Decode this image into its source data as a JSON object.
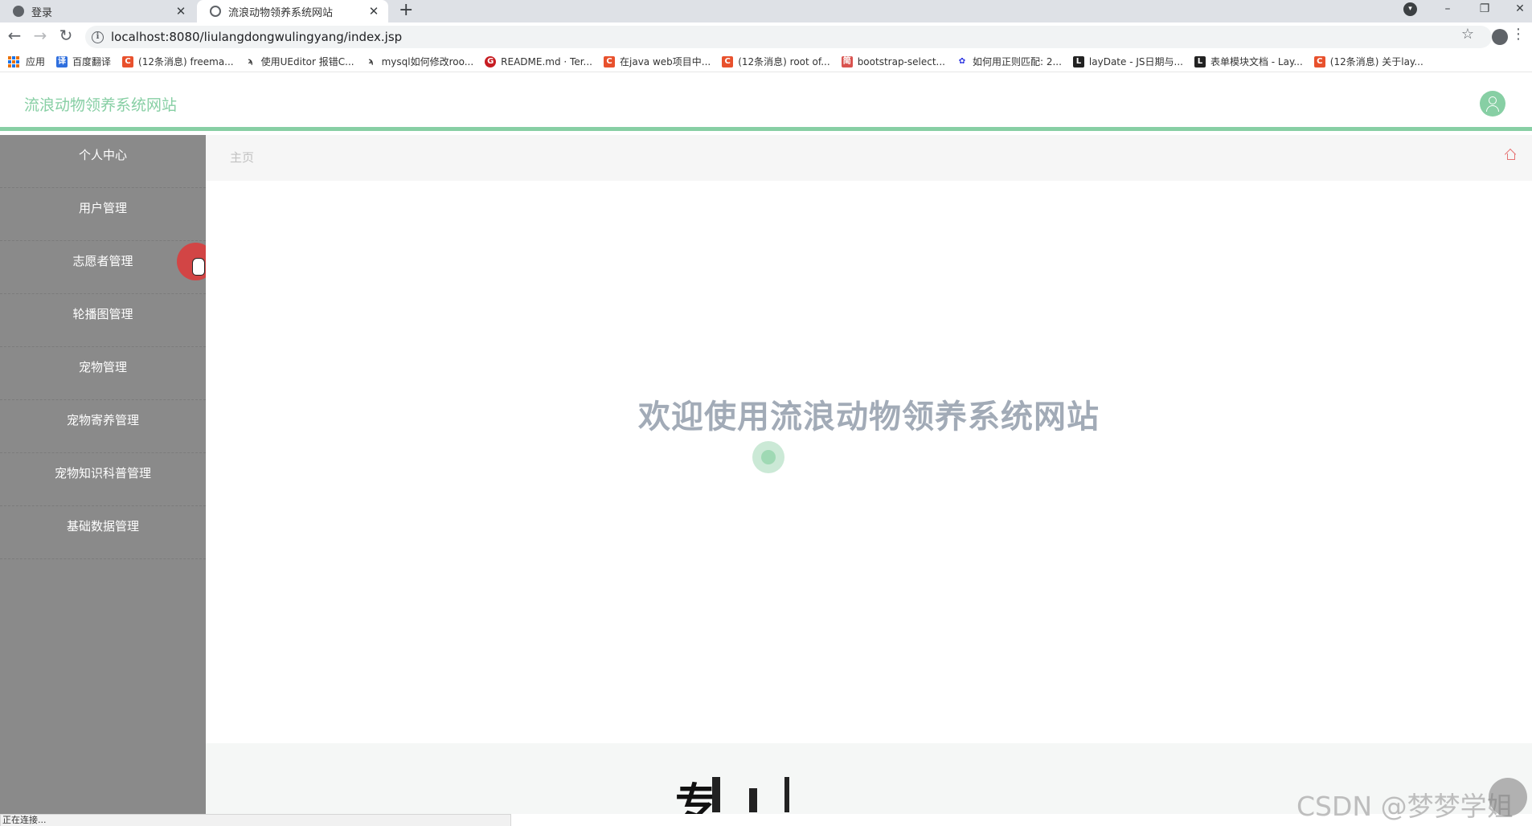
{
  "browser": {
    "tabs": [
      {
        "title": "登录",
        "active": false,
        "close": "✕"
      },
      {
        "title": "流浪动物领养系统网站",
        "active": true,
        "close": "✕"
      }
    ],
    "new_tab": "+",
    "url": "localhost:8080/liulangdongwulingyang/index.jsp",
    "bookmarks": [
      {
        "label": "应用",
        "icon": "apps-icon"
      },
      {
        "label": "百度翻译",
        "icon": "baidu-translate-icon"
      },
      {
        "label": "(12条消息) freema...",
        "icon": "csdn-icon"
      },
      {
        "label": "使用UEditor 报错C...",
        "icon": "bird-icon"
      },
      {
        "label": "mysql如何修改roo...",
        "icon": "bird-icon"
      },
      {
        "label": "README.md · Ter...",
        "icon": "gitee-icon"
      },
      {
        "label": "在java web项目中...",
        "icon": "csdn-icon"
      },
      {
        "label": "(12条消息) root of...",
        "icon": "csdn-icon"
      },
      {
        "label": "bootstrap-select...",
        "icon": "book-icon"
      },
      {
        "label": "如何用正则匹配: 2...",
        "icon": "baidu-icon"
      },
      {
        "label": "layDate - JS日期与...",
        "icon": "layui-icon"
      },
      {
        "label": "表单模块文档 - Lay...",
        "icon": "layui-icon"
      },
      {
        "label": "(12条消息) 关于lay...",
        "icon": "csdn-icon"
      }
    ],
    "status": "正在连接..."
  },
  "app": {
    "title": "流浪动物领养系统网站",
    "menu": [
      {
        "label": "个人中心"
      },
      {
        "label": "用户管理"
      },
      {
        "label": "志愿者管理"
      },
      {
        "label": "轮播图管理"
      },
      {
        "label": "宠物管理"
      },
      {
        "label": "宠物寄养管理"
      },
      {
        "label": "宠物知识科普管理"
      },
      {
        "label": "基础数据管理"
      }
    ],
    "breadcrumb": "主页",
    "welcome": "欢迎使用流浪动物领养系统网站",
    "footer_text": "专"
  },
  "overlay": {
    "watermark": "CSDN @梦梦学姐"
  },
  "colors": {
    "accent": "#87cfa4",
    "sidebar": "#8a8a8a",
    "welcome": "#a2abb7",
    "home_icon": "#e57373"
  }
}
